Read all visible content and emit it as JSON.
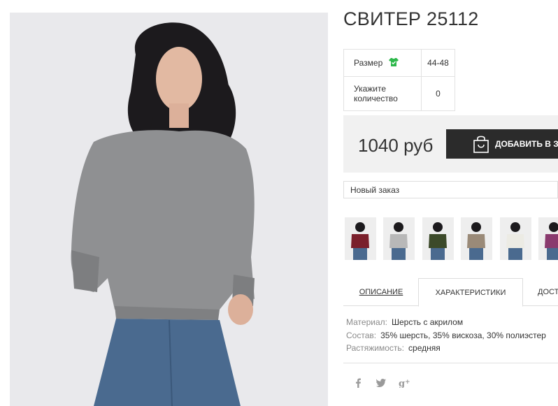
{
  "product": {
    "title": "СВИТЕР 25112",
    "size_label": "Размер",
    "size_value": "44-48",
    "qty_label": "Укажите количество",
    "qty_value": "0",
    "price": "1040 руб",
    "add_to_cart": "ДОБАВИТЬ В ЗАКАЗ",
    "order_select": "Новый заказ"
  },
  "colors": {
    "accent_green": "#2db84b",
    "button_dark": "#2b2b2b",
    "price_bg": "#f1f1f1"
  },
  "thumbnails": [
    {
      "sweater": "#7a1f2b"
    },
    {
      "sweater": "#b8b8b8"
    },
    {
      "sweater": "#3c4a2a"
    },
    {
      "sweater": "#9a8a78"
    },
    {
      "sweater": "#ecebe4"
    },
    {
      "sweater": "#8a3a6e"
    }
  ],
  "tabs": {
    "description": "ОПИСАНИЕ",
    "characteristics": "ХАРАКТЕРИСТИКИ",
    "delivery": "ДОСТАВКА"
  },
  "properties": [
    {
      "key": "Материал:",
      "value": "Шерсть с акрилом"
    },
    {
      "key": "Состав:",
      "value": "35% шерсть, 35% вискоза, 30% полиэстер"
    },
    {
      "key": "Растяжимость:",
      "value": "средняя"
    }
  ],
  "social": [
    {
      "icon": "facebook-icon",
      "glyph": "f"
    },
    {
      "icon": "twitter-icon",
      "glyph": "🐦"
    },
    {
      "icon": "google-plus-icon",
      "glyph": "g+"
    }
  ]
}
